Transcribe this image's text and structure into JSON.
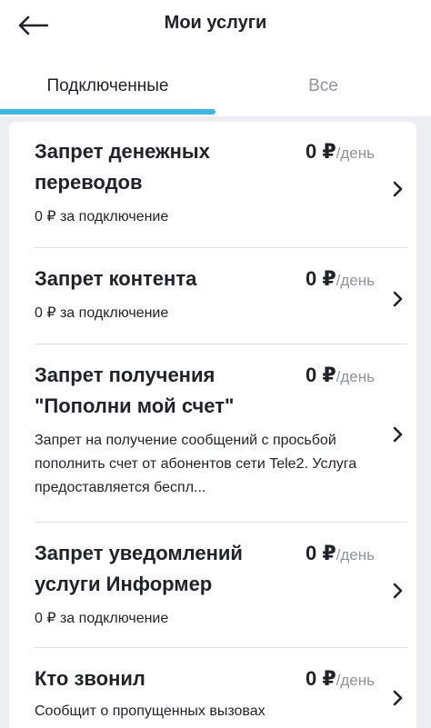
{
  "header": {
    "title": "Мои услуги",
    "back_icon": "arrow-left-icon"
  },
  "tabs": [
    {
      "label": "Подключенные",
      "active": true
    },
    {
      "label": "Все",
      "active": false
    }
  ],
  "colors": {
    "accent": "#3fb6e8",
    "text": "#1f2229",
    "muted": "#8f949c",
    "background": "#eceef1"
  },
  "services": [
    {
      "title": "Запрет денежных переводов",
      "price": "0 ₽",
      "unit": "/день",
      "subtitle": "0 ₽ за подключение"
    },
    {
      "title": "Запрет контента",
      "price": "0 ₽",
      "unit": "/день",
      "subtitle": "0 ₽ за подключение"
    },
    {
      "title": "Запрет получения \"Пополни мой счет\"",
      "price": "0 ₽",
      "unit": "/день",
      "description": "Запрет на получение сообщений с просьбой пополнить счет от абонентов сети Tele2. Услуга предоставляется беспл..."
    },
    {
      "title": "Запрет уведомлений услуги Информер",
      "price": "0 ₽",
      "unit": "/день",
      "subtitle": "0 ₽ за подключение"
    },
    {
      "title": "Кто звонил",
      "price": "0 ₽",
      "unit": "/день",
      "description": "Сообщит о пропущенных вызовах"
    }
  ]
}
